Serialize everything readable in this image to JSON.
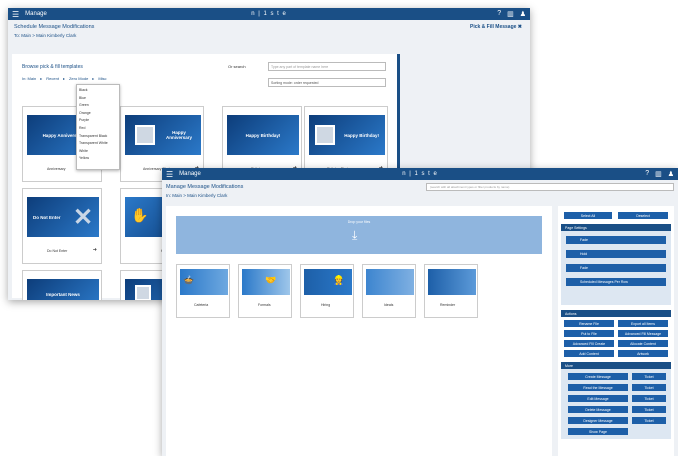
{
  "back": {
    "bar": {
      "menu": "Manage",
      "logo": "n | 1 s t e",
      "icons": [
        "?",
        "▥",
        "♟"
      ]
    },
    "title": "Schedule Message Modifications",
    "subtitle": "To: Main  >  Main Kimberly Clark",
    "topright": "Pick & Fill Message ✖",
    "browse": "Browse pick & fill templates",
    "crumb": [
      "In: Main",
      "Recent",
      "Zero Mode",
      "Misc"
    ],
    "search_label": "Or search",
    "search_placeholder": "Type any part of template name here",
    "sort_value": "Sorting mode: order requested",
    "dropdown": [
      "Black",
      "Blue",
      "Green",
      "Orange",
      "Purple",
      "Red",
      "Transparent Black",
      "Transparent White",
      "White",
      "Yellow"
    ],
    "cards": [
      {
        "thumb": "Happy Anniversary",
        "label": "Anniversary"
      },
      {
        "thumb": "Happy Anniversary",
        "label": "Anniversary Photo"
      },
      {
        "thumb": "Happy Birthday!",
        "label": "Birthday"
      },
      {
        "thumb": "Happy Birthday!",
        "label": "Birthday Photo"
      },
      {
        "thumb": "Do Not Enter",
        "label": "Do Not Enter"
      },
      {
        "thumb": "",
        "label": "Hand"
      },
      {
        "thumb": "Important News",
        "label": ""
      },
      {
        "thumb": "",
        "label": ""
      }
    ]
  },
  "front": {
    "bar": {
      "menu": "Manage",
      "logo": "n | 1 s t e",
      "icons": [
        "?",
        "▥",
        "♟"
      ]
    },
    "title": "Manage Message Modifications",
    "subtitle": "In: Main  >  Main Kimberly Clark",
    "search_placeholder": "(search with all attachment types or filter products by name)",
    "drop_text": "Drop your files",
    "cards": [
      {
        "label": "Cafeteria",
        "thumb": ""
      },
      {
        "label": "Formals",
        "thumb": ""
      },
      {
        "label": "Hiring",
        "thumb": ""
      },
      {
        "label": "Ideals",
        "thumb": ""
      },
      {
        "label": "Reminder",
        "thumb": ""
      }
    ],
    "side": {
      "top_buttons": [
        "Select All",
        "Deselect"
      ],
      "page_settings": "Page Settings",
      "ps_items": [
        "Fade",
        "Hold",
        "Fade",
        "Scheduled Messages Per Row"
      ],
      "actions": "Actions",
      "action_buttons": [
        "Rename File",
        "Export all Items",
        "Put to File",
        "Advanced Fill Message",
        "Advanced Fill Create",
        "Allocate Content",
        "Add Content",
        "Artwork"
      ],
      "more": "More",
      "more_buttons": [
        [
          "Create Message",
          "Ticket"
        ],
        [
          "Read the Message",
          "Ticket"
        ],
        [
          "Edit Message",
          "Ticket"
        ],
        [
          "Delete Message",
          "Ticket"
        ],
        [
          "Designer Message",
          "Ticket"
        ],
        [
          "Show Page",
          ""
        ]
      ]
    }
  }
}
